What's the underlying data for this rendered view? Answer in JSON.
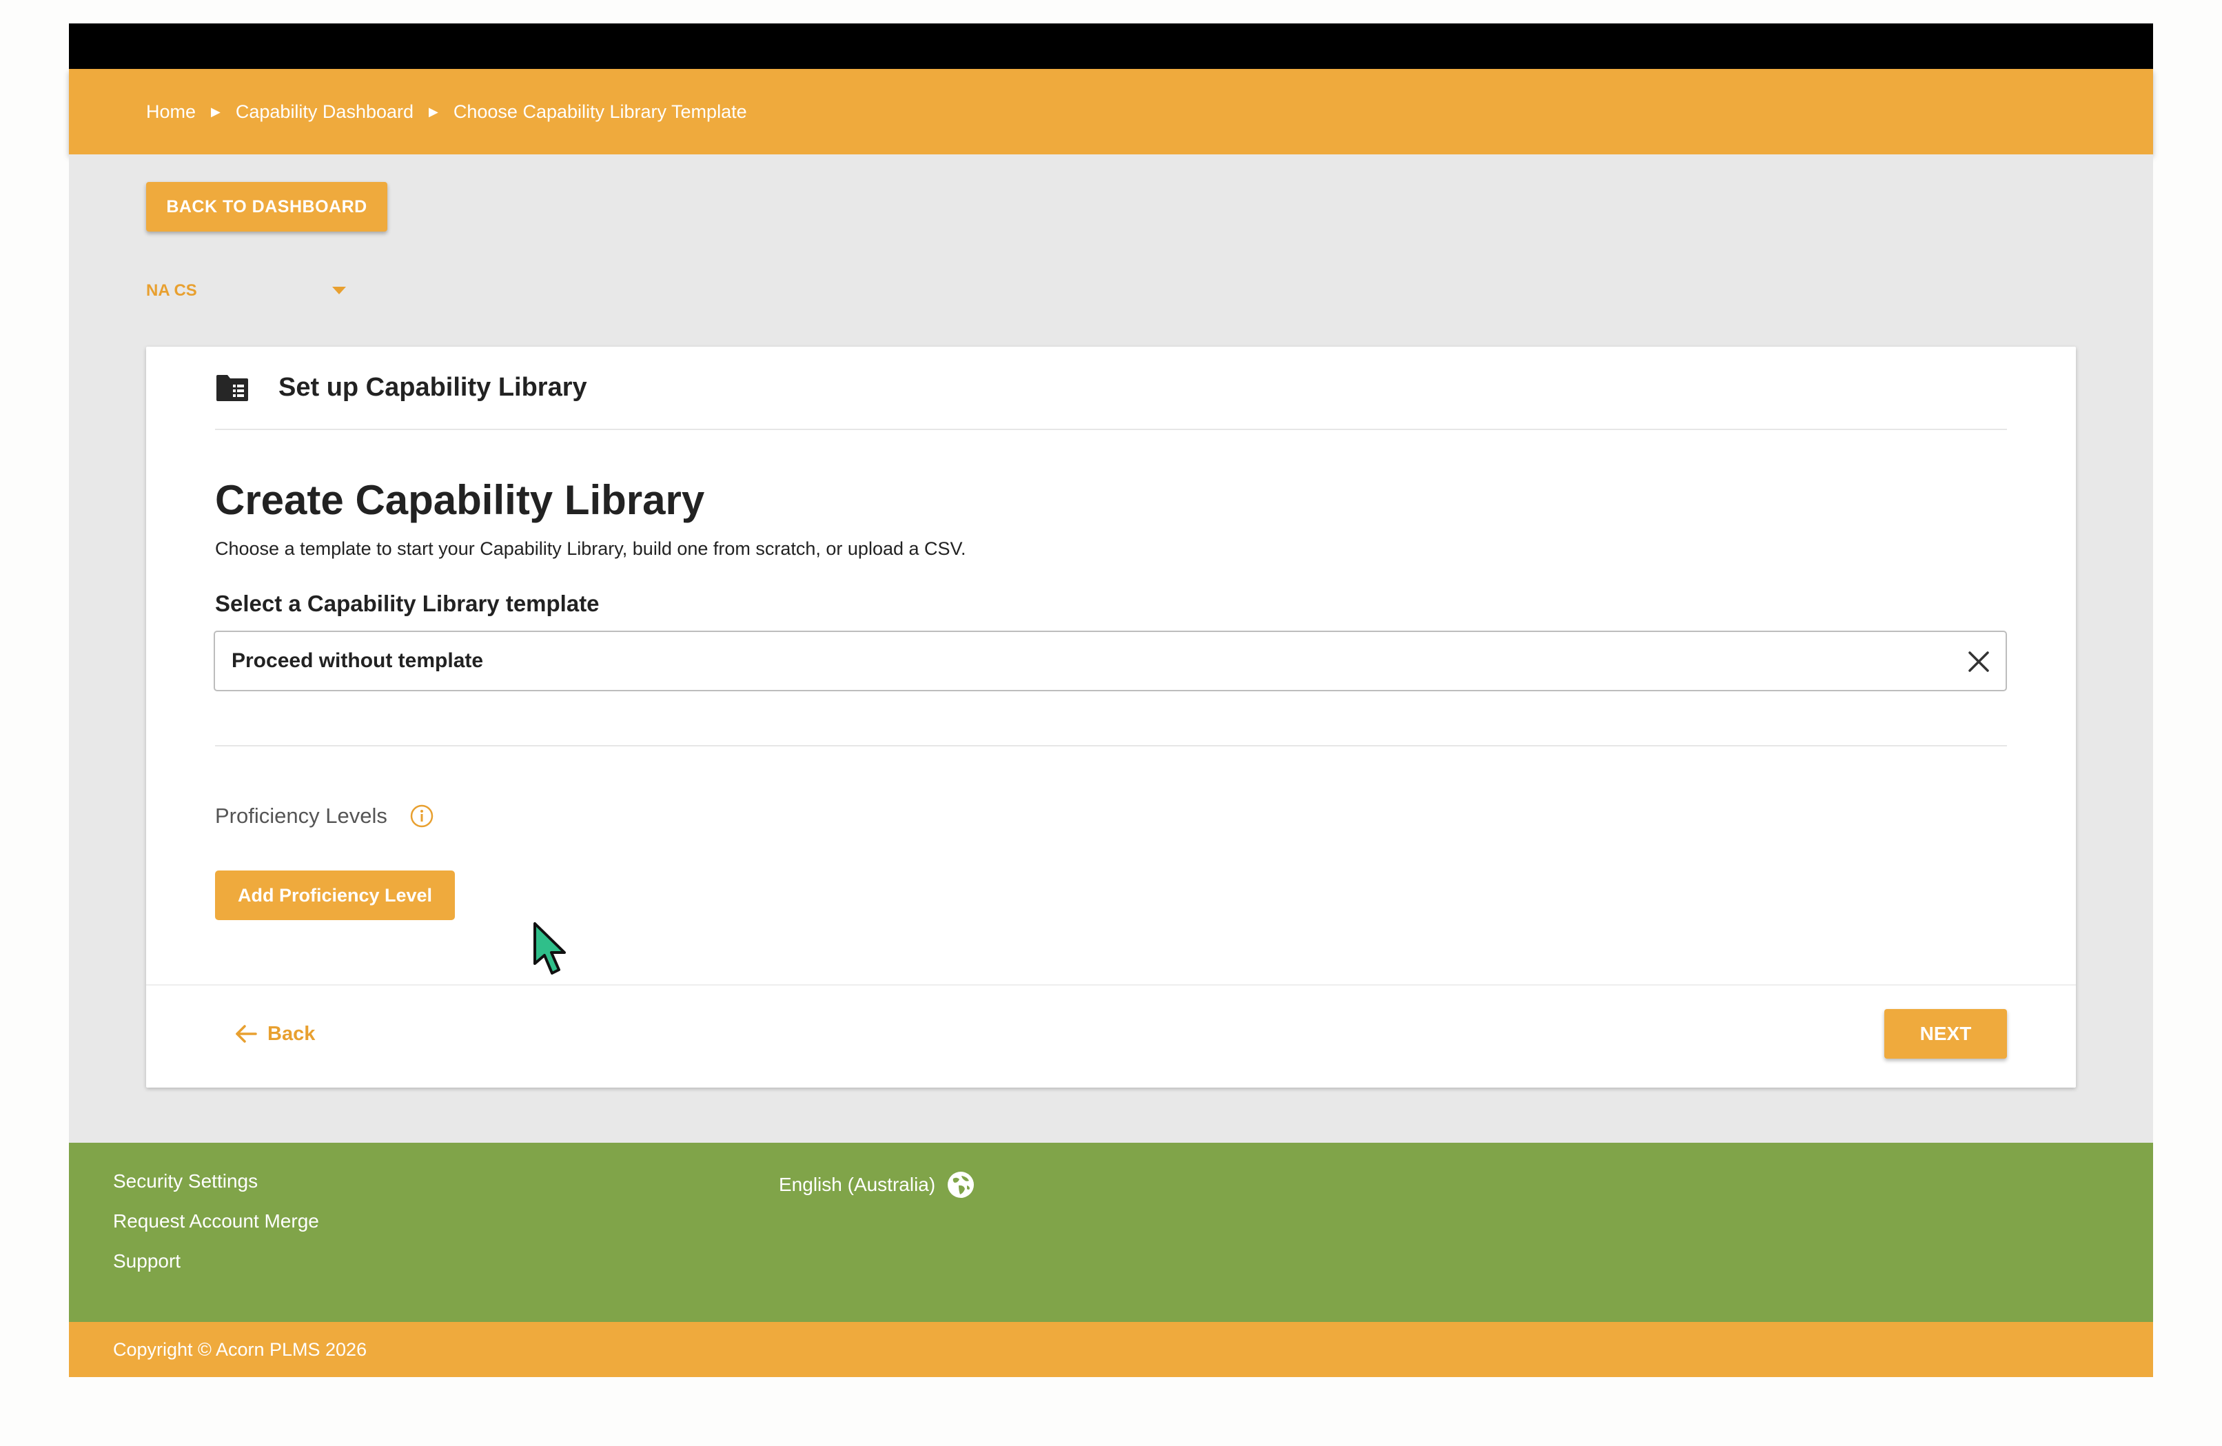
{
  "breadcrumb": {
    "items": [
      "Home",
      "Capability Dashboard",
      "Choose Capability Library Template"
    ],
    "separator": "▶"
  },
  "actions": {
    "back_to_dashboard": "BACK TO DASHBOARD"
  },
  "org_select": {
    "value": "NA CS"
  },
  "card": {
    "header_title": "Set up Capability Library",
    "title": "Create Capability Library",
    "description": "Choose a template to start your Capability Library, build one from scratch, or upload a CSV.",
    "template_label": "Select a Capability Library template",
    "template_value": "Proceed without template",
    "proficiency_label": "Proficiency Levels",
    "add_proficiency_button": "Add Proficiency Level",
    "back_label": "Back",
    "next_label": "NEXT"
  },
  "footer": {
    "links": [
      "Security Settings",
      "Request Account Merge",
      "Support"
    ],
    "language": "English (Australia)",
    "copyright": "Copyright © Acorn PLMS 2026"
  },
  "colors": {
    "accent": "#efaa3d",
    "footer_green": "#80a449",
    "topbar": "#000000",
    "background": "#e8e8e8"
  },
  "icons": {
    "header": "folder-list-icon",
    "clear": "close-icon",
    "info": "info-circle-icon",
    "back": "arrow-left-icon",
    "language": "globe-icon",
    "org_select": "caret-down-icon",
    "cursor": "mouse-pointer-icon"
  }
}
